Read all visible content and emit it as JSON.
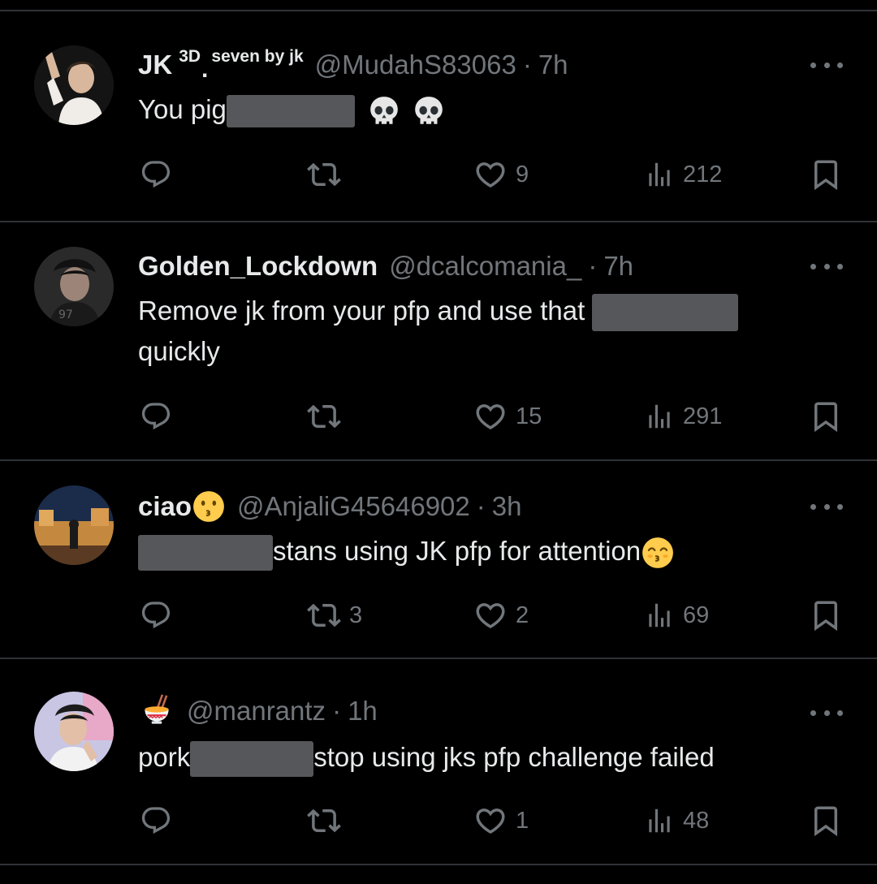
{
  "tweets": [
    {
      "name": "JK",
      "badge_3d": "3D",
      "badge_dot": ".",
      "badge_seven": "seven by jk",
      "handle": "@MudahS83063",
      "dot": "·",
      "time": "7h",
      "text_before": "You pig",
      "text_after": "",
      "text_line2": "",
      "avatar_icon": "avatar-woman-pink",
      "emojis": [
        "skull-emoji",
        "skull-emoji"
      ],
      "reply_count": "",
      "retweet_count": "",
      "like_count": "9",
      "view_count": "212"
    },
    {
      "name": "Golden_Lockdown",
      "handle": "@dcalcomania_",
      "dot": "·",
      "time": "7h",
      "text_before": "Remove jk from your pfp and use that",
      "text_after": "",
      "text_line2": "quickly",
      "avatar_icon": "avatar-man-dark",
      "reply_count": "",
      "retweet_count": "",
      "like_count": "15",
      "view_count": "291"
    },
    {
      "name": "ciao",
      "name_emoji": "kissing-face-emoji",
      "handle": "@AnjaliG45646902",
      "dot": "·",
      "time": "3h",
      "text_before": "",
      "text_after": "stans using JK pfp for attention",
      "text_line2": "",
      "avatar_icon": "avatar-night-city",
      "emojis": [
        "kissing-smiling-eyes-emoji"
      ],
      "reply_count": "",
      "retweet_count": "3",
      "like_count": "2",
      "view_count": "69"
    },
    {
      "name": "",
      "name_emoji": "noodle-bowl-emoji",
      "handle": "@manrantz",
      "dot": "·",
      "time": "1h",
      "text_before": "pork",
      "text_after": "stop using jks pfp challenge failed",
      "text_line2": "",
      "avatar_icon": "avatar-man-light",
      "reply_count": "",
      "retweet_count": "",
      "like_count": "1",
      "view_count": "48"
    }
  ],
  "colors": {
    "background": "#000000",
    "text": "#e7e9ea",
    "muted": "#71767b",
    "divider": "#2f3336",
    "redaction": "#56575a"
  }
}
